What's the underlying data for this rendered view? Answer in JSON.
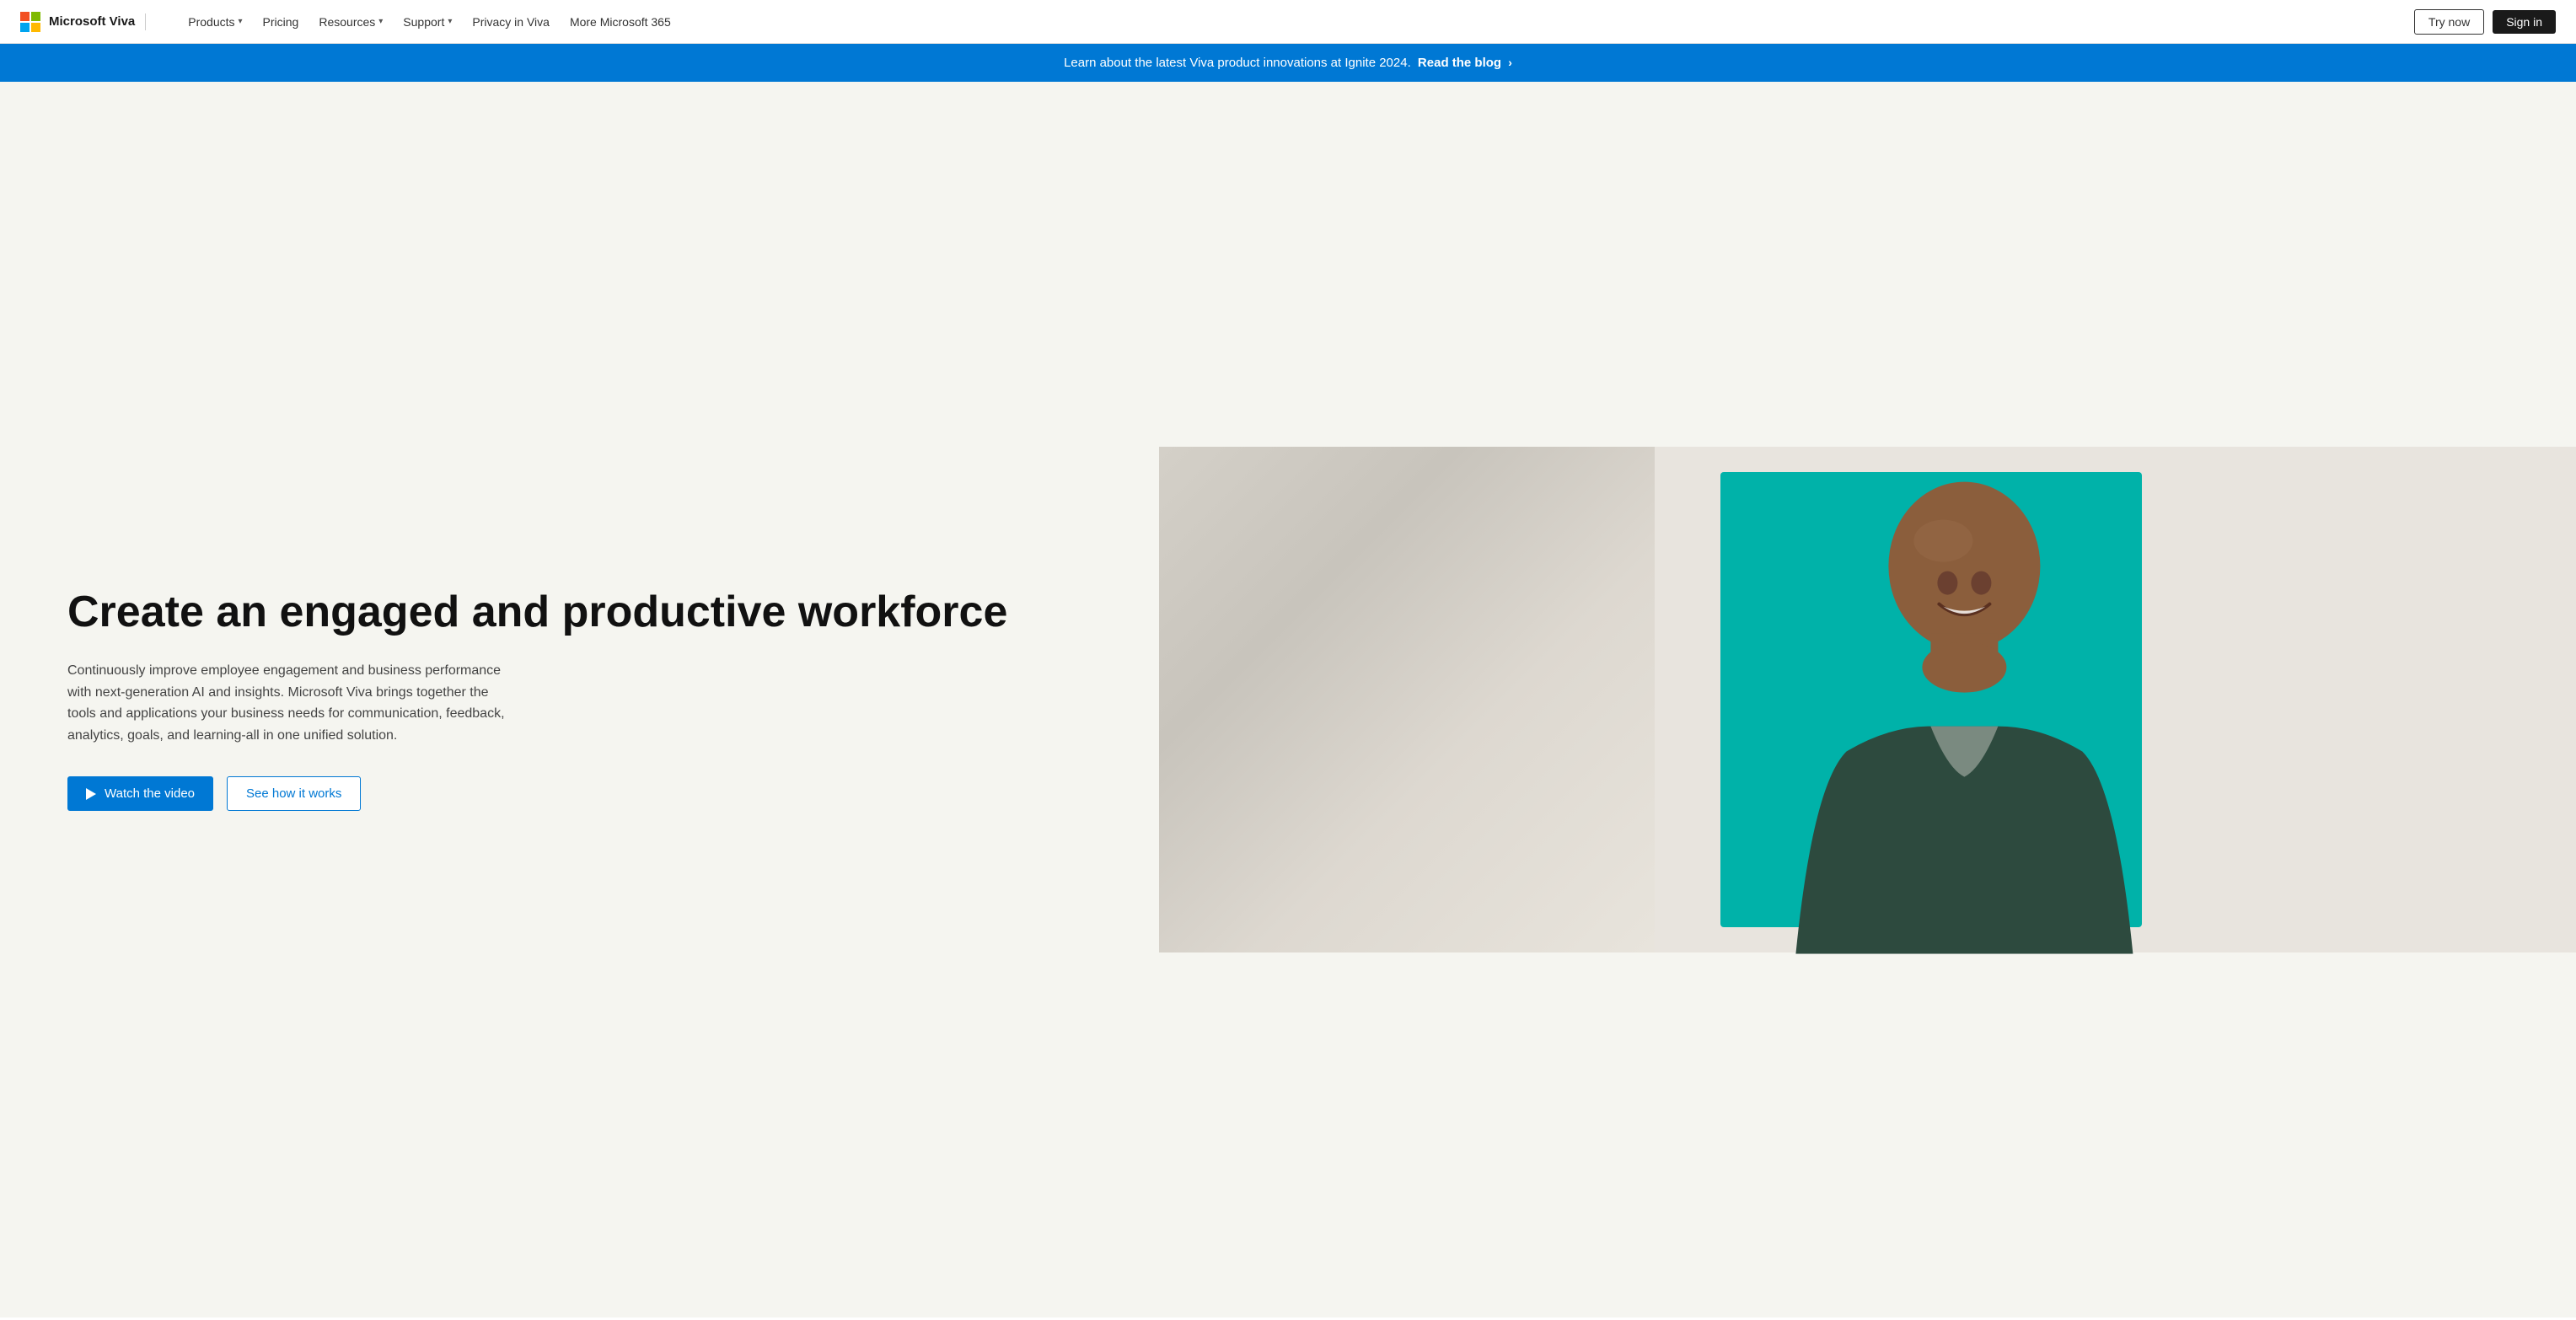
{
  "navbar": {
    "brand": "Microsoft Viva",
    "logo_alt": "Microsoft",
    "separator": true,
    "nav_items": [
      {
        "label": "Products",
        "has_dropdown": true
      },
      {
        "label": "Pricing",
        "has_dropdown": false
      },
      {
        "label": "Resources",
        "has_dropdown": true
      },
      {
        "label": "Support",
        "has_dropdown": true
      },
      {
        "label": "Privacy in Viva",
        "has_dropdown": false
      },
      {
        "label": "More Microsoft 365",
        "has_dropdown": false
      }
    ],
    "try_now_label": "Try now",
    "sign_in_label": "Sign in"
  },
  "banner": {
    "text": "Learn about the latest Viva product innovations at Ignite 2024.",
    "link_text": "Read the blog",
    "link_chevron": "›"
  },
  "hero": {
    "title": "Create an engaged and productive workforce",
    "description": "Continuously improve employee engagement and business performance with next-generation AI and insights. Microsoft Viva brings together the tools and applications your business needs for communication, feedback, analytics, goals, and learning-all in one unified solution.",
    "watch_video_label": "Watch the video",
    "see_how_label": "See how it works"
  }
}
